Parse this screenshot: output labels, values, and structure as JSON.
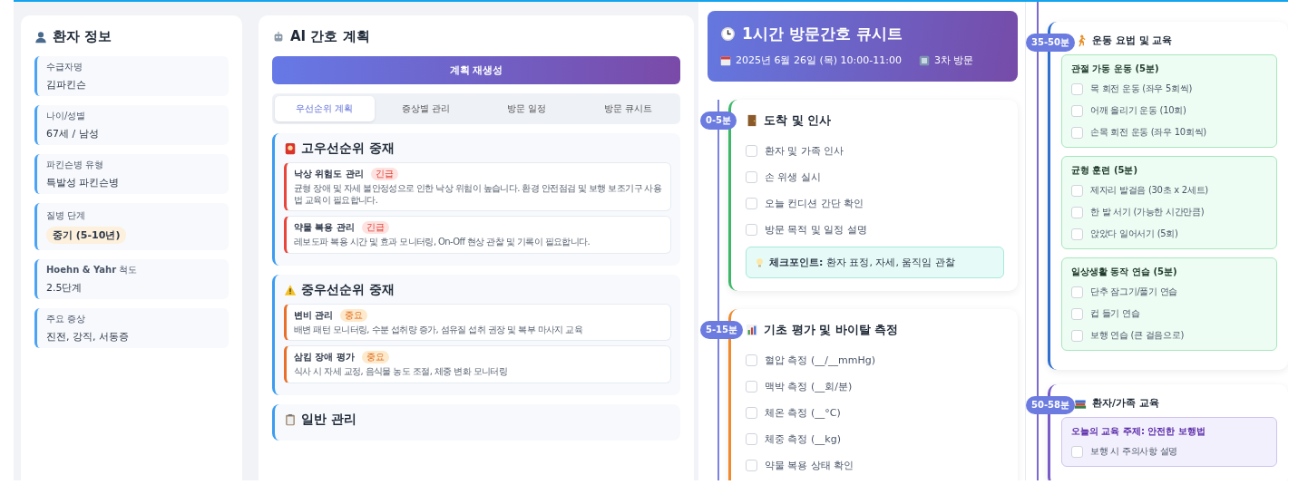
{
  "patient": {
    "title": "환자 정보",
    "fields": [
      {
        "label": "수급자명",
        "value": "김파킨슨",
        "kind": "text"
      },
      {
        "label": "나이/성별",
        "value": "67세 / 남성",
        "kind": "text"
      },
      {
        "label": "파킨슨병 유형",
        "value": "특발성 파킨슨병",
        "kind": "text"
      },
      {
        "label": "질병 단계",
        "value": "중기 (5-10년)",
        "kind": "badge"
      },
      {
        "label": "**Hoehn & Yahr** 척도",
        "value": "2.5단계",
        "kind": "text"
      },
      {
        "label": "주요 증상",
        "value": "진전, 강직, 서동증",
        "kind": "text"
      }
    ]
  },
  "plan": {
    "title": "AI 간호 계획",
    "button": "계획 재생성",
    "tabs": [
      {
        "label": "우선순위 계획",
        "selected": true
      },
      {
        "label": "증상별 관리",
        "selected": false
      },
      {
        "label": "방문 일정",
        "selected": false
      },
      {
        "label": "방문 큐시트",
        "selected": false
      }
    ],
    "sections": [
      {
        "kind": "high",
        "title": "고우선순위 중재",
        "items": [
          {
            "title": "낙상 위험도 관리",
            "badge": "긴급",
            "kind": "urgent",
            "text": "균형 장애 및 자세 불안정성으로 인한 낙상 위험이 높습니다. 환경 안전점검 및 보행 보조기구 사용법 교육이 필요합니다."
          },
          {
            "title": "약물 복용 관리",
            "badge": "긴급",
            "kind": "urgent",
            "text": "레보도파 복용 시간 및 효과 모니터링, On-Off 현상 관찰 및 기록이 필요합니다."
          }
        ]
      },
      {
        "kind": "medium",
        "title": "중우선순위 중재",
        "items": [
          {
            "title": "변비 관리",
            "badge": "중요",
            "kind": "important",
            "text": "배변 패턴 모니터링, 수분 섭취량 증가, 섬유질 섭취 권장 및 복부 마사지 교육"
          },
          {
            "title": "삼킴 장애 평가",
            "badge": "중요",
            "kind": "important",
            "text": "식사 시 자세 교정, 음식물 농도 조절, 체중 변화 모니터링"
          }
        ]
      },
      {
        "kind": "general",
        "title": "일반 관리"
      }
    ]
  },
  "cuesheet": {
    "title": "1시간 방문간호 큐시트",
    "date": "2025년 6월 26일 (목) 10:00-11:00",
    "visit": "3차 방문"
  },
  "steps_left": [
    {
      "kind": "arrival",
      "time": "0-5분",
      "title": "도착 및 인사",
      "color": "#3cb868",
      "items": [
        {
          "label": "환자 및 가족 인사",
          "checked": false
        },
        {
          "label": "손 위생 실시",
          "checked": false
        },
        {
          "label": "오늘 컨디션 간단 확인",
          "checked": false
        },
        {
          "label": "방문 목적 및 일정 설명",
          "checked": false
        }
      ],
      "note": "**체크포인트:** 환자 표정, 자세, 움직임 관찰"
    },
    {
      "kind": "assessment",
      "time": "5-15분",
      "title": "기초 평가 및 바이탈 측정",
      "color": "#f08a2c",
      "items": [
        {
          "label": "혈압 측정 (__/__mmHg)",
          "checked": false
        },
        {
          "label": "맥박 측정 (__회/분)",
          "checked": false
        },
        {
          "label": "체온 측정 (__°C)",
          "checked": false
        },
        {
          "label": "체중 측정 (__kg)",
          "checked": false
        },
        {
          "label": "약물 복용 상태 확인",
          "checked": false
        }
      ]
    }
  ],
  "steps_right": [
    {
      "kind": "exercise",
      "time": "35-50분",
      "title": "운동 요법 및 교육",
      "color": "#2f6fd0",
      "groups": [
        {
          "title": "관절 가동 운동 (5분)",
          "items": [
            {
              "label": "목 회전 운동 (좌우 5회씩)",
              "checked": false
            },
            {
              "label": "어깨 올리기 운동 (10회)",
              "checked": false
            },
            {
              "label": "손목 회전 운동 (좌우 10회씩)",
              "checked": false
            }
          ]
        },
        {
          "title": "균형 훈련 (5분)",
          "items": [
            {
              "label": "제자리 발걸음 (30초 x 2세트)",
              "checked": false
            },
            {
              "label": "한 발 서기 (가능한 시간만큼)",
              "checked": false
            },
            {
              "label": "앉았다 일어서기 (5회)",
              "checked": false
            }
          ]
        },
        {
          "title": "일상생활 동작 연습 (5분)",
          "items": [
            {
              "label": "단추 잠그기/풀기 연습",
              "checked": false
            },
            {
              "label": "컵 들기 연습",
              "checked": false
            },
            {
              "label": "보행 연습 (큰 걸음으로)",
              "checked": false
            }
          ]
        }
      ]
    },
    {
      "kind": "education",
      "time": "50-58분",
      "title": "환자/가족 교육",
      "color": "#7a5cc8",
      "groups": [
        {
          "title": "오늘의 교육 주제: 안전한 보행법",
          "items": [
            {
              "label": "보행 시 주의사항 설명",
              "checked": false
            }
          ]
        }
      ]
    }
  ]
}
